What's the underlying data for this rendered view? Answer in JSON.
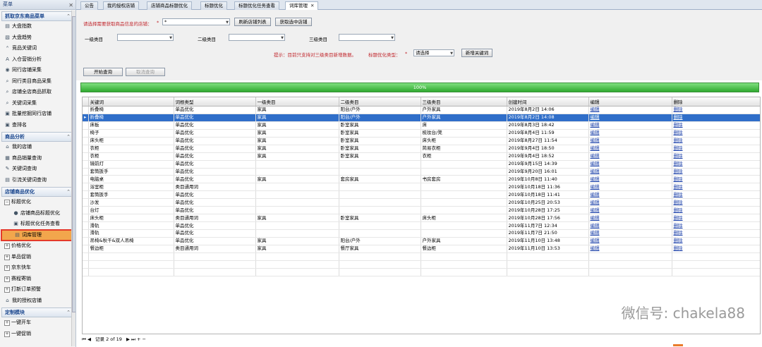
{
  "sidebar": {
    "title": "菜单",
    "sections": [
      {
        "label": "抓取京东商品菜单",
        "items": [
          "大盘指数",
          "大盘趋势",
          "竞品关键词",
          "入仓营销分析",
          "同行店铺采集",
          "同行类目商品采集",
          "店铺全店商品抓取",
          "关键词采集",
          "批量挖掘同行店铺",
          "查排名"
        ]
      },
      {
        "label": "商品分析",
        "items": [
          "我的店铺",
          "商品销量查询",
          "关键词查询",
          "引流关键词查询"
        ]
      },
      {
        "label": "店铺商品优化",
        "items": [
          "标题优化",
          "店铺商品标题优化",
          "标题优化任务查看",
          "词库管理",
          "价格优化",
          "单品促销",
          "京东快车",
          "赛程寄销",
          "打新订单预警",
          "我的授权店铺"
        ]
      },
      {
        "label": "定制模块",
        "items": [
          "一键开车",
          "一键促销"
        ]
      }
    ]
  },
  "tabs": [
    "公告",
    "我的授权店铺",
    "店铺商品标题优化",
    "标题优化",
    "标题优化任务查看",
    "词库管理"
  ],
  "filter": {
    "store_label": "请选择需要获取商品信息的店铺：",
    "store_value": "*",
    "refresh_btn": "刷新店铺列表",
    "select_btn": "获取选中店铺",
    "cat1_label": "一级类目",
    "cat2_label": "二级类目",
    "cat3_label": "三级类目",
    "hint": "提示：目前只支持对三级类目新增数据。",
    "type_label": "标题优化类型：",
    "type_value": "请选择",
    "add_btn": "新增关键词",
    "start_btn": "开始查询",
    "cancel_btn": "取消查询"
  },
  "progress": {
    "percent": 100,
    "label": "100%"
  },
  "grid": {
    "columns": [
      "关键词",
      "词根类型",
      "一级类目",
      "二级类目",
      "三级类目",
      "创建时间",
      "编辑",
      "删除"
    ],
    "rows": [
      [
        "折叠椅",
        "单品优化",
        "家具",
        "阳台/户外",
        "户外家具",
        "2019年8月2日 14:06",
        "编辑",
        "删除"
      ],
      [
        "折叠椅",
        "单品优化",
        "家具",
        "阳台/户外",
        "户外家具",
        "2019年8月2日 14:08",
        "编辑",
        "删除"
      ],
      [
        "床板",
        "单品优化",
        "家具",
        "卧室家具",
        "床",
        "2019年8月3日 18:42",
        "编辑",
        "删除"
      ],
      [
        "椅子",
        "单品优化",
        "家具",
        "卧室家具",
        "梳妆台/凳",
        "2019年8月4日 11:59",
        "编辑",
        "删除"
      ],
      [
        "床头柜",
        "单品优化",
        "家具",
        "卧室家具",
        "床头柜",
        "2019年8月27日 11:54",
        "编辑",
        "删除"
      ],
      [
        "衣柜",
        "单品优化",
        "家具",
        "卧室家具",
        "简易衣柜",
        "2019年9月4日 18:50",
        "编辑",
        "删除"
      ],
      [
        "衣柜",
        "单品优化",
        "家具",
        "卧室家具",
        "衣柜",
        "2019年9月4日 18:52",
        "编辑",
        "删除"
      ],
      [
        "镜前灯",
        "单品优化",
        "",
        "",
        "",
        "2019年9月15日 14:39",
        "编辑",
        "删除"
      ],
      [
        "套筒扳手",
        "单品优化",
        "",
        "",
        "",
        "2019年9月20日 16:01",
        "编辑",
        "删除"
      ],
      [
        "电脑桌",
        "单品优化",
        "家具",
        "套房家具",
        "书房套房",
        "2019年10月8日 11:40",
        "编辑",
        "删除"
      ],
      [
        "浴室柜",
        "类目通用词",
        "",
        "",
        "",
        "2019年10月18日 11:36",
        "编辑",
        "删除"
      ],
      [
        "套筒扳手",
        "单品优化",
        "",
        "",
        "",
        "2019年10月18日 11:41",
        "编辑",
        "删除"
      ],
      [
        "沙发",
        "单品优化",
        "",
        "",
        "",
        "2019年10月25日 20:53",
        "编辑",
        "删除"
      ],
      [
        "台灯",
        "单品优化",
        "",
        "",
        "",
        "2019年10月28日 17:25",
        "编辑",
        "删除"
      ],
      [
        "床头柜",
        "类目通用词",
        "家具",
        "卧室家具",
        "床头柜",
        "2019年10月28日 17:56",
        "编辑",
        "删除"
      ],
      [
        "滑轨",
        "单品优化",
        "",
        "",
        "",
        "2019年11月7日 12:34",
        "编辑",
        "删除"
      ],
      [
        "滑轨",
        "单品优化",
        "",
        "",
        "",
        "2019年11月7日 21:50",
        "编辑",
        "删除"
      ],
      [
        "吊椅&秋千&双人吊椅",
        "单品优化",
        "家具",
        "阳台/户外",
        "户外家具",
        "2019年11月10日 13:48",
        "编辑",
        "删除"
      ],
      [
        "餐边柜",
        "类目通用词",
        "家具",
        "餐厅家具",
        "餐边柜",
        "2019年11月10日 13:53",
        "编辑",
        "删除"
      ],
      [
        "",
        "",
        "",
        "",
        "",
        "",
        "",
        ""
      ],
      [
        "",
        "",
        "",
        "",
        "",
        "",
        "",
        ""
      ],
      [
        "",
        "",
        "",
        "",
        "",
        "",
        "",
        ""
      ]
    ],
    "selected_row": 1
  },
  "pager": {
    "text": "记录 2 of 19"
  },
  "watermark": "微信号: chakela88"
}
